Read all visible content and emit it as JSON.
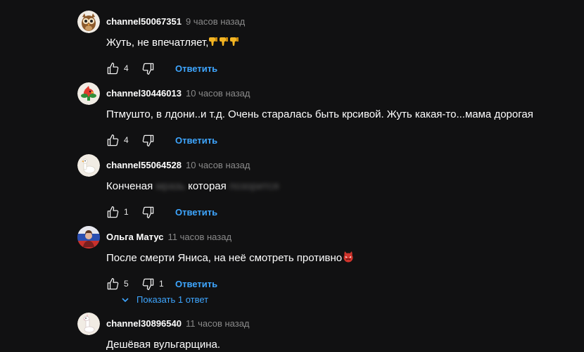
{
  "reply_label": "Ответить",
  "comments": [
    {
      "author": "channel50067351",
      "time": "9 часов назад",
      "text": "Жуть, не впечатляет,",
      "likes": "4",
      "emoji": "thumbs-down-icon ×3"
    },
    {
      "author": "channel30446013",
      "time": "10 часов назад",
      "text": "Птмушто, в лдони..и т.д. Очень старалась быть крсивой. Жуть какая-то...мама дорогая",
      "likes": "4"
    },
    {
      "author": "channel55064528",
      "time": "10 часов назад",
      "text_before": "Конченая",
      "text_hidden_1": "мразь",
      "text_middle": "которая",
      "text_hidden_2": "позорится",
      "likes": "1"
    },
    {
      "author": "Ольга Матус",
      "time": "11 часов назад",
      "text": "После смерти Яниса, на неё смотреть противно",
      "likes": "5",
      "dislikes": "1",
      "show_replies": "Показать 1 ответ"
    },
    {
      "author": "channel30896540",
      "time": "11 часов назад",
      "text": "Дешёвая вульгарщина."
    }
  ],
  "colors": {
    "background": "#111112",
    "link": "#3ea6ff",
    "muted": "#8a8a8a"
  }
}
